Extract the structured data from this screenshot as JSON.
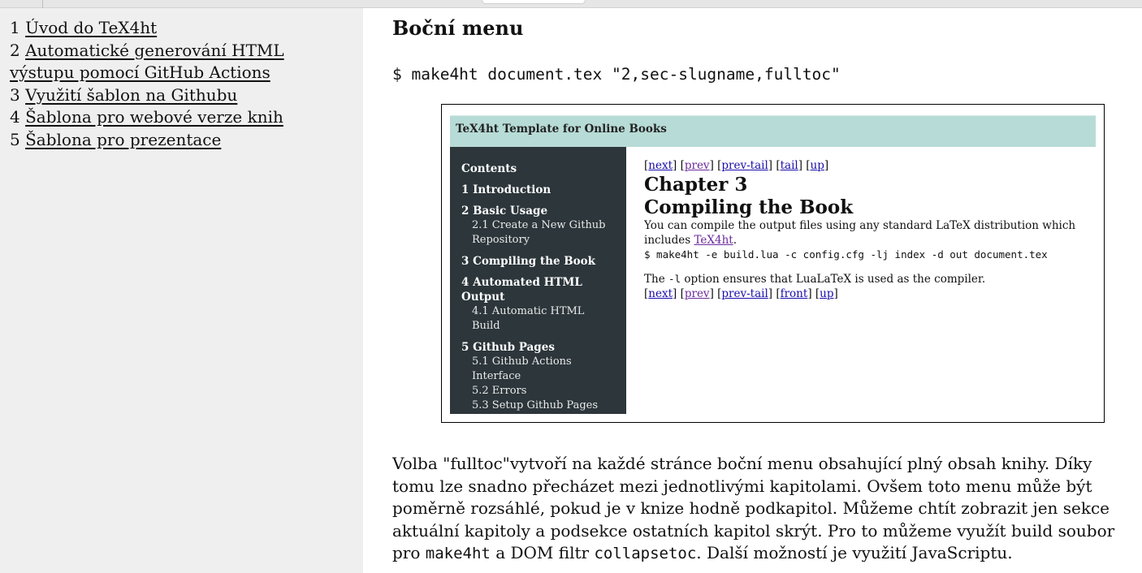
{
  "sidebar": {
    "items": [
      {
        "num": "1",
        "label": "Úvod do TeX4ht"
      },
      {
        "num": "2",
        "label": "Automatické generování HTML výstupu pomocí GitHub Actions"
      },
      {
        "num": "3",
        "label": "Využití šablon na Githubu"
      },
      {
        "num": "4",
        "label": "Šablona pro webové verze knih"
      },
      {
        "num": "5",
        "label": "Šablona pro prezentace"
      }
    ]
  },
  "main": {
    "heading": "Boční menu",
    "command": "$ make4ht document.tex \"2,sec-slugname,fulltoc\"",
    "paragraph": {
      "text1": "Volba \"fulltoc\"vytvoří na každé stránce boční menu obsahující plný obsah knihy. Díky tomu lze snadno přecházet mezi jednotlivými kapitolami. Ovšem toto menu může být poměrně rozsáhlé, pokud je v knize hodně podkapitol. Můžeme chtít zobrazit jen sekce aktuální kapitoly a podsekce ostatních kapitol skrýt. Pro to můžeme využít build soubor pro ",
      "code1": "make4ht",
      "text2": " a DOM filtr ",
      "code2": "collapsetoc",
      "text3": ". Další možností je využití JavaScriptu."
    }
  },
  "screenshot": {
    "header_title": "TeX4ht Template for Online Books",
    "toc": {
      "title": "Contents",
      "chapters": [
        {
          "label": "1 Introduction",
          "subs": []
        },
        {
          "label": "2 Basic Usage",
          "subs": [
            "2.1 Create a New Github Repository"
          ]
        },
        {
          "label": "3 Compiling the Book",
          "subs": []
        },
        {
          "label": "4 Automated HTML Output",
          "subs": [
            "4.1 Automatic HTML Build"
          ]
        },
        {
          "label": "5 Github Pages",
          "subs": [
            "5.1 Github Actions Interface",
            "5.2 Errors",
            "5.3 Setup Github Pages"
          ]
        }
      ]
    },
    "nav_top": {
      "next": "next",
      "prev": "prev",
      "prev_tail": "prev-tail",
      "tail": "tail",
      "up": "up"
    },
    "chapter_num": "Chapter 3",
    "chapter_title": "Compiling the Book",
    "intro_text": "You can compile the output files using any standard LaTeX distribution which includes ",
    "intro_link": "TeX4ht",
    "intro_end": ".",
    "command": "$ make4ht -e build.lua -c config.cfg -lj index -d out document.tex",
    "option_pre": "The ",
    "option_code": "-l",
    "option_post": " option ensures that LuaLaTeX is used as the compiler.",
    "nav_bottom": {
      "next": "next",
      "prev": "prev",
      "prev_tail": "prev-tail",
      "front": "front",
      "up": "up"
    }
  }
}
